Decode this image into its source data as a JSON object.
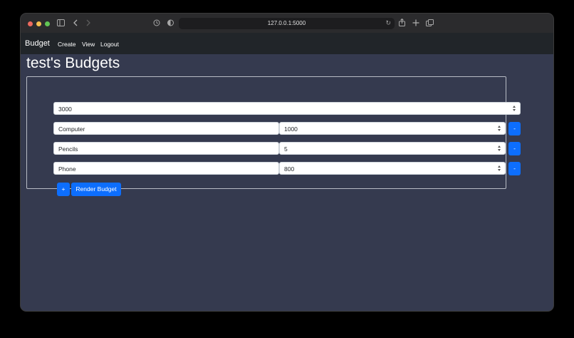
{
  "browser": {
    "url": "127.0.0.1:5000"
  },
  "navbar": {
    "brand": "Budget",
    "links": [
      "Create",
      "View",
      "Logout"
    ]
  },
  "page": {
    "title": "test's Budgets"
  },
  "budget": {
    "total": "3000",
    "items": [
      {
        "name": "Computer",
        "amount": "1000"
      },
      {
        "name": "Pencils",
        "amount": "5"
      },
      {
        "name": "Phone",
        "amount": "800"
      }
    ],
    "remove_label": "-",
    "add_label": "+",
    "render_label": "Render Budget"
  },
  "colors": {
    "page_bg": "#353a4f",
    "navbar_bg": "#212529",
    "primary": "#0d6efd"
  },
  "icons": [
    "sidebar-icon",
    "back-icon",
    "forward-icon",
    "history-icon",
    "shield-icon",
    "reload-icon",
    "share-icon",
    "new-tab-icon",
    "tabs-icon",
    "spinner-icon"
  ]
}
